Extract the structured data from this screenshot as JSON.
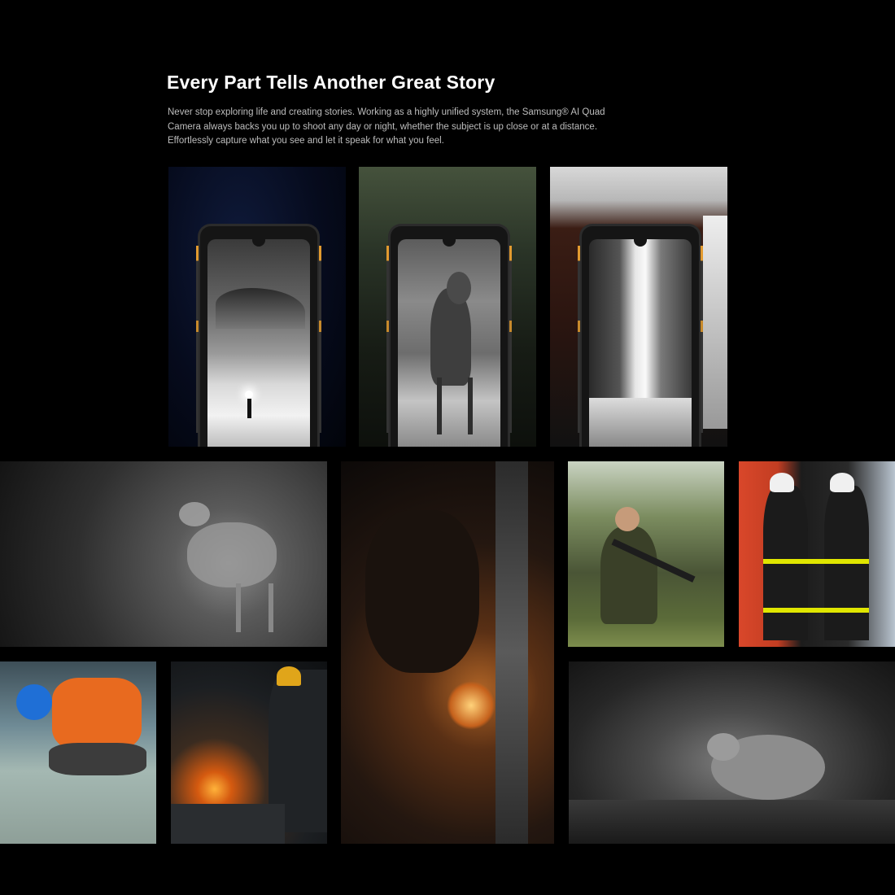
{
  "header": {
    "title": "Every Part Tells Another Great Story",
    "description": "Never stop exploring life and creating stories. Working as a highly unified system, the Samsung® AI Quad Camera always backs you up to shoot any day or night, whether the subject is up close or at a distance. Effortlessly capture what you see and let it speak for what you feel."
  },
  "colors": {
    "background": "#000000",
    "phone_accent": "#e29a2f"
  },
  "gallery": {
    "phone_shots": [
      "night-snow-village",
      "deer-monochrome",
      "waterfall"
    ],
    "photos": [
      "night-vision-deer",
      "angle-grinder-sparks",
      "soldier-in-forest",
      "firefighters",
      "construction-worker",
      "blacksmith-forge",
      "night-vision-bird"
    ]
  }
}
